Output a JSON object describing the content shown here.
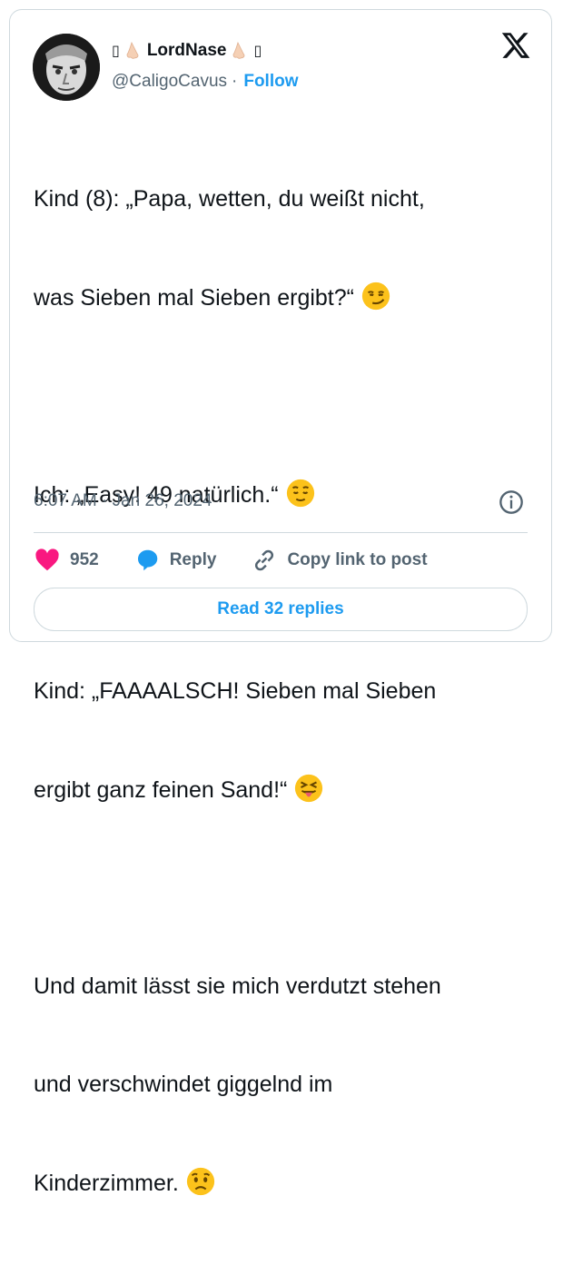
{
  "author": {
    "display_name": "LordNase",
    "prefix_glyph": "▯",
    "suffix_glyph": "▯",
    "handle": "@CaligoCavus",
    "separator": "·",
    "follow_label": "Follow"
  },
  "tweet": {
    "lines": [
      "Kind (8): „Papa, wetten, du weißt nicht,",
      "was Sieben mal Sieben ergibt?“",
      "",
      "Ich: „Easy! 49 natürlich.“",
      "",
      "Kind: „FAAAALSCH! Sieben mal Sieben",
      "ergibt ganz feinen Sand!“",
      "",
      "Und damit lässt sie mich verdutzt stehen",
      "und verschwindet giggelnd im",
      "Kinderzimmer."
    ],
    "emojis": [
      "smirking-face",
      "relieved-face",
      "squinting-face-with-tongue",
      "worried-face"
    ]
  },
  "meta": {
    "timestamp": "6:07 AM · Jan 26, 2024"
  },
  "actions": {
    "likes_count": "952",
    "reply_label": "Reply",
    "copy_link_label": "Copy link to post"
  },
  "footer": {
    "read_replies_label": "Read 32 replies"
  },
  "colors": {
    "accent": "#1d9bf0",
    "like": "#f91880",
    "muted": "#536471",
    "text": "#0f1419",
    "border": "#cfd9de"
  }
}
